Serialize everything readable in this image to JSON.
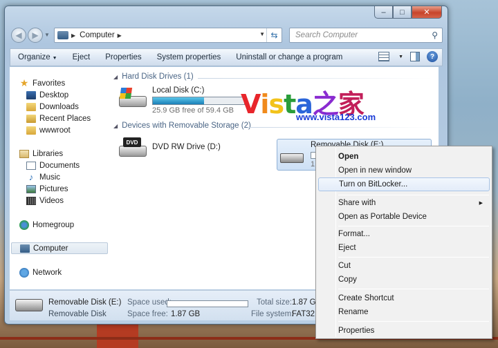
{
  "window": {
    "caption_buttons": {
      "minimize": "–",
      "maximize": "□",
      "close": "✕"
    }
  },
  "navbar": {
    "address": "Computer",
    "search_placeholder": "Search Computer"
  },
  "toolbar": {
    "organize": "Organize",
    "eject": "Eject",
    "properties": "Properties",
    "system_properties": "System properties",
    "uninstall": "Uninstall or change a program"
  },
  "sidebar": {
    "favorites": "Favorites",
    "desktop": "Desktop",
    "downloads": "Downloads",
    "recent_places": "Recent Places",
    "wwwroot": "wwwroot",
    "libraries": "Libraries",
    "documents": "Documents",
    "music": "Music",
    "pictures": "Pictures",
    "videos": "Videos",
    "homegroup": "Homegroup",
    "computer": "Computer",
    "network": "Network"
  },
  "content": {
    "hdd_group": "Hard Disk Drives (1)",
    "removable_group": "Devices with Removable Storage (2)",
    "local_disk": {
      "name": "Local Disk (C:)",
      "free": "25.9 GB free of 59.4 GB",
      "used_fraction": 0.56
    },
    "dvd": {
      "name": "DVD RW Drive (D:)",
      "icon_label": "DVD"
    },
    "removable": {
      "name": "Removable Disk (E:)",
      "size_fragment": "1."
    }
  },
  "watermark": {
    "chars": [
      {
        "ch": "V",
        "color": "#e8252b"
      },
      {
        "ch": "i",
        "color": "#f08a1c"
      },
      {
        "ch": "s",
        "color": "#f2c31a"
      },
      {
        "ch": "t",
        "color": "#2a9d3a"
      },
      {
        "ch": "a",
        "color": "#2b65d9"
      },
      {
        "ch": "之",
        "color": "#8a2bd0"
      },
      {
        "ch": "家",
        "color": "#c21f5a"
      }
    ],
    "url": "www.vista123.com"
  },
  "details": {
    "name": "Removable Disk (E:)",
    "type": "Removable Disk",
    "space_used_label": "Space used:",
    "space_free_label": "Space free:",
    "space_free": "1.87 GB",
    "total_size_label": "Total size:",
    "total_size": "1.87 GB",
    "file_system_label": "File system:",
    "file_system": "FAT32"
  },
  "context_menu": {
    "open": "Open",
    "open_new_window": "Open in new window",
    "bitlocker": "Turn on BitLocker...",
    "share_with": "Share with",
    "open_portable": "Open as Portable Device",
    "format": "Format...",
    "eject": "Eject",
    "cut": "Cut",
    "copy": "Copy",
    "create_shortcut": "Create Shortcut",
    "rename": "Rename",
    "properties": "Properties"
  }
}
